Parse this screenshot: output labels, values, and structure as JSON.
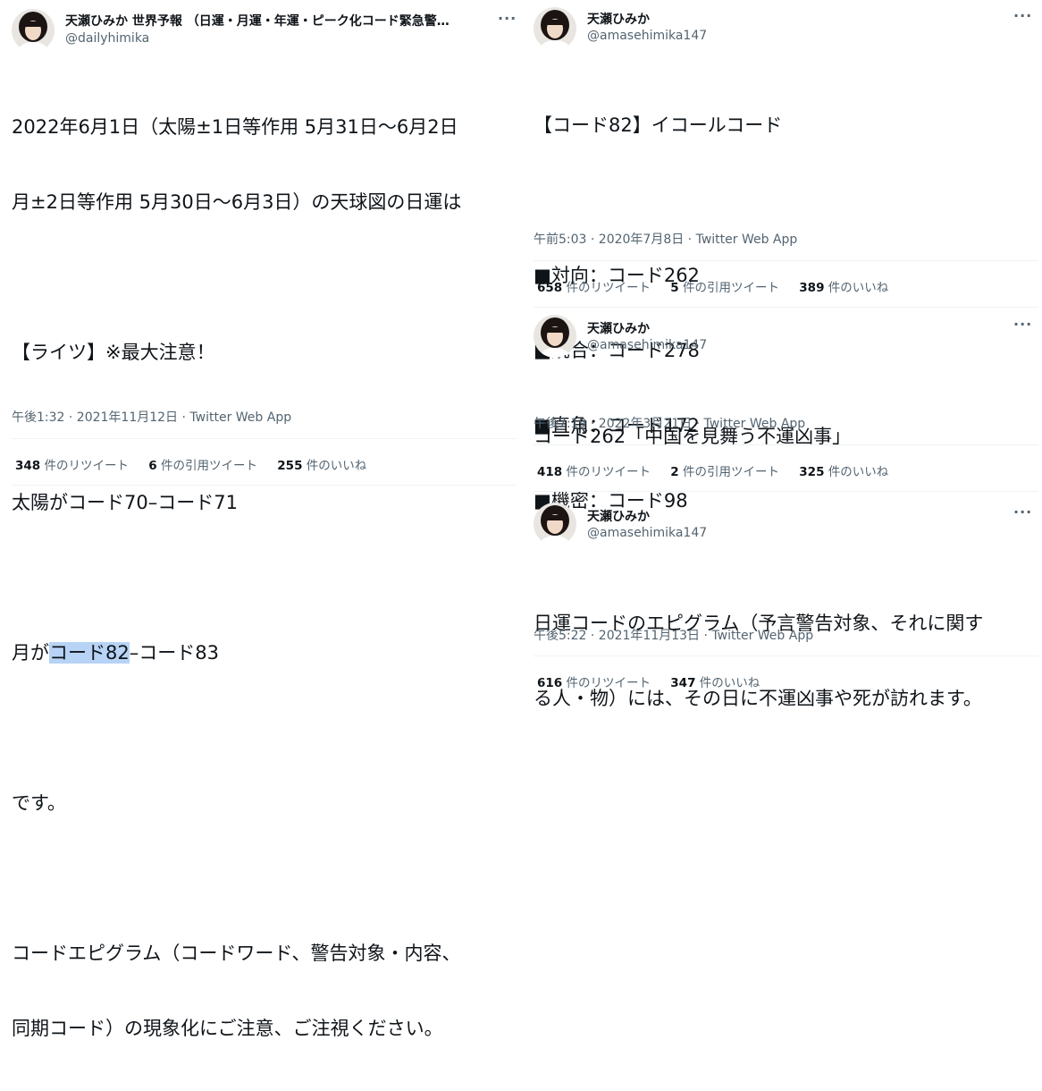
{
  "left_tweet": {
    "author_name": "天瀬ひみか 世界予報 （日運・月運・年運・ピーク化コード緊急警…",
    "author_handle": "@dailyhimika",
    "lines": [
      "2022年6月1日（太陽±1日等作用 5月31日〜6月2日",
      "月±2日等作用 5月30日〜6月3日）の天球図の日運は",
      "",
      "【ライツ】※最大注意！",
      "",
      "太陽がコード70–コード71",
      "",
      "",
      "",
      "です。",
      "",
      "コードエピグラム（コードワード、警告対象・内容、",
      "同期コード）の現象化にご注意、ご注視ください。"
    ],
    "moon_line": {
      "prefix": "月が",
      "highlight": "コード82",
      "suffix": "–コード83"
    },
    "meta": "午後1:32 · 2021年11月12日 · Twitter Web App",
    "retweets": {
      "count": "348",
      "label": "件のリツイート"
    },
    "quotes": {
      "count": "6",
      "label": "件の引用ツイート"
    },
    "likes": {
      "count": "255",
      "label": "件のいいね"
    }
  },
  "right_tweets": [
    {
      "author_name": "天瀬ひみか",
      "author_handle": "@amasehimika147",
      "lines": [
        "【コード82】イコールコード",
        "",
        "■対向：コード262",
        "■統合：コード278",
        "■直角：コード172",
        "■機密：コード98"
      ],
      "meta": "午前5:03 · 2020年7月8日 · Twitter Web App",
      "retweets": {
        "count": "658",
        "label": "件のリツイート"
      },
      "quotes": {
        "count": "5",
        "label": "件の引用ツイート"
      },
      "likes": {
        "count": "389",
        "label": "件のいいね"
      }
    },
    {
      "author_name": "天瀬ひみか",
      "author_handle": "@amasehimika147",
      "lines": [
        "コード262「中国を見舞う不運凶事」"
      ],
      "meta": "午後7:19 · 2022年3月21日 · Twitter Web App",
      "retweets": {
        "count": "418",
        "label": "件のリツイート"
      },
      "quotes": {
        "count": "2",
        "label": "件の引用ツイート"
      },
      "likes": {
        "count": "325",
        "label": "件のいいね"
      }
    },
    {
      "author_name": "天瀬ひみか",
      "author_handle": "@amasehimika147",
      "lines": [
        "日運コードのエピグラム（予言警告対象、それに関す",
        "る人・物）には、その日に不運凶事や死が訪れます。"
      ],
      "meta": "午後5:22 · 2021年11月13日 · Twitter Web App",
      "retweets": {
        "count": "616",
        "label": "件のリツイート"
      },
      "likes": {
        "count": "347",
        "label": "件のいいね"
      }
    }
  ],
  "more_icon_glyph": "···",
  "colors": {
    "highlight": "#b7d3f5",
    "secondary_text": "#536471",
    "divider": "#eff3f4"
  }
}
